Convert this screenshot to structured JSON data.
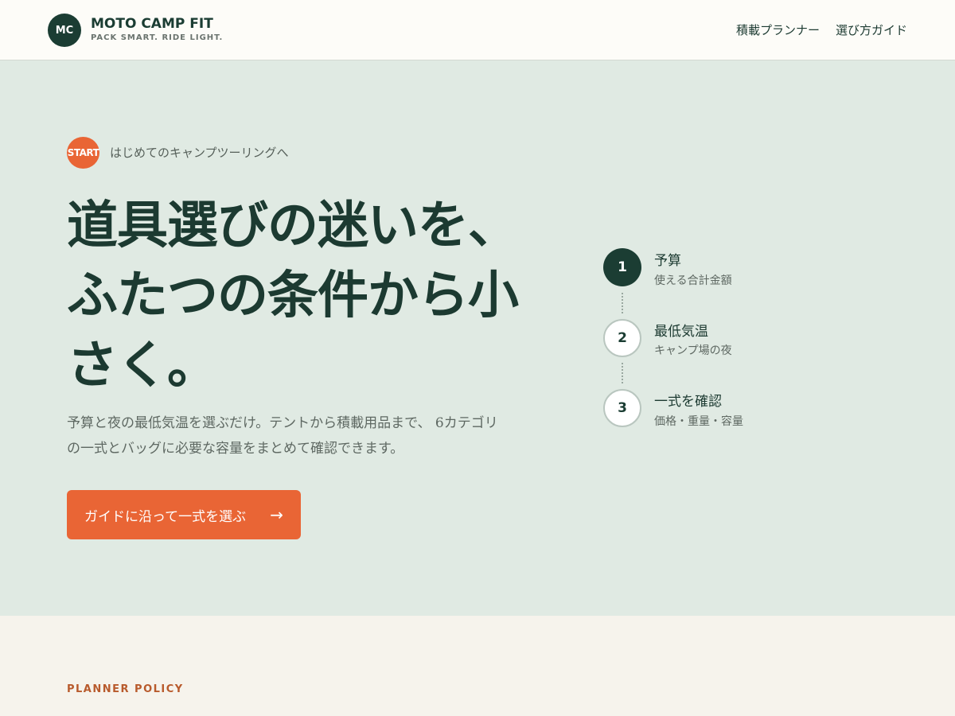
{
  "header": {
    "logo_text": "MC",
    "brand_name": "MOTO CAMP FIT",
    "brand_tagline": "PACK SMART. RIDE LIGHT.",
    "nav": [
      {
        "label": "積載プランナー"
      },
      {
        "label": "選び方ガイド"
      }
    ]
  },
  "hero": {
    "badge": "START",
    "eyebrow": "はじめてのキャンプツーリングへ",
    "headline_lines": [
      "道具選びの迷いを、",
      "ふたつの条件から小",
      "さく。"
    ],
    "lead_lines": [
      "予算と夜の最低気温を選ぶだけ。テントから積載用品まで、 6カテゴリ",
      "の一式とバッグに必要な容量をまとめて確認できます。"
    ],
    "cta_label": "ガイドに沿って一式を選ぶ",
    "cta_arrow": "→"
  },
  "steps": [
    {
      "number": "1",
      "title": "予算",
      "subtitle": "使える合計金額",
      "active": true
    },
    {
      "number": "2",
      "title": "最低気温",
      "subtitle": "キャンプ場の夜",
      "active": false
    },
    {
      "number": "3",
      "title": "一式を確認",
      "subtitle": "価格・重量・容量",
      "active": false
    }
  ],
  "policy": {
    "label": "PLANNER POLICY"
  },
  "colors": {
    "accent": "#e96535",
    "brand": "#1b3d33",
    "hero_bg": "#e0eae3"
  }
}
